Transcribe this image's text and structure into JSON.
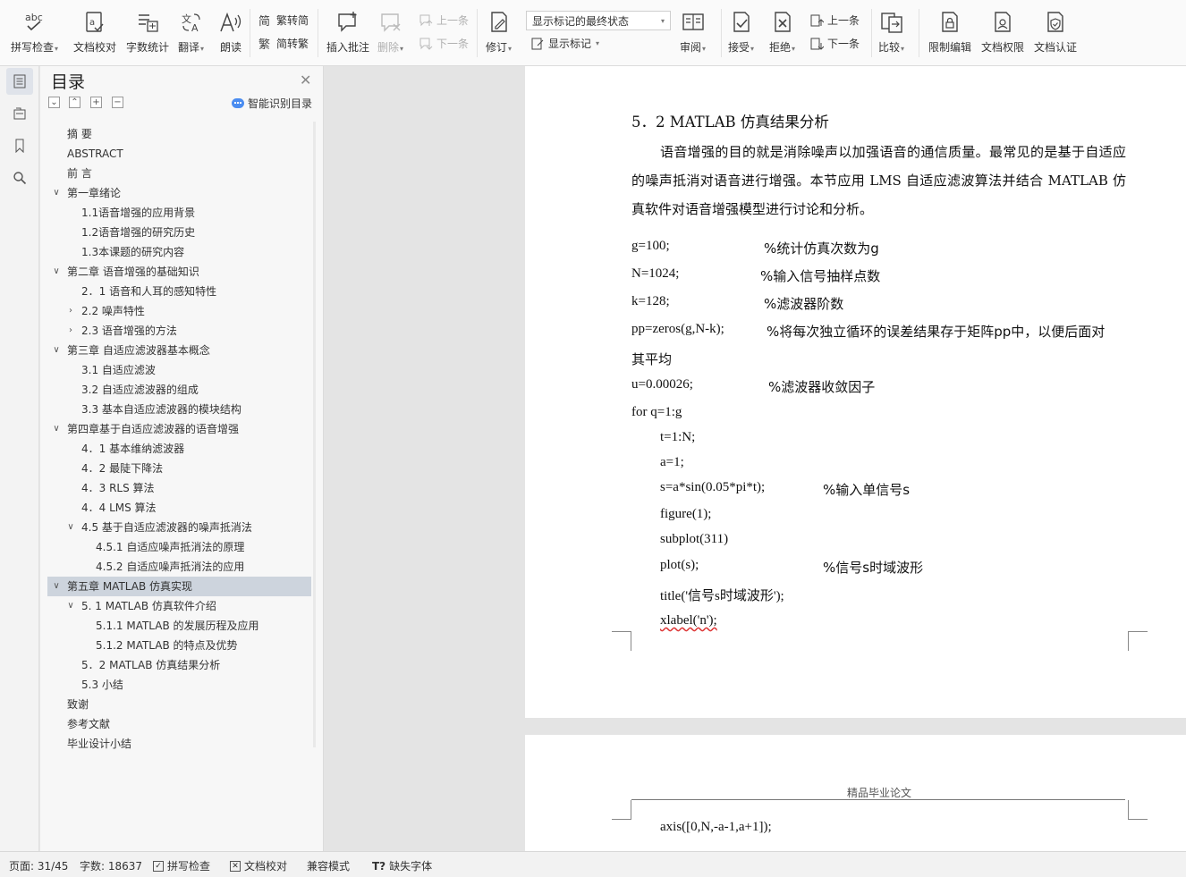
{
  "ribbon": {
    "spell_check": "拼写检查",
    "doc_proof": "文档校对",
    "word_count": "字数统计",
    "translate": "翻译",
    "read_aloud": "朗读",
    "trad_to_simp": "繁转简",
    "simp_to_trad": "简转繁",
    "insert_comment": "插入批注",
    "delete": "删除",
    "prev_comment": "上一条",
    "next_comment": "下一条",
    "revise": "修订",
    "markup_dropdown": "显示标记的最终状态",
    "show_markup": "显示标记",
    "review": "审阅",
    "accept": "接受",
    "reject": "拒绝",
    "prev_change": "上一条",
    "next_change": "下一条",
    "compare": "比较",
    "restrict_edit": "限制编辑",
    "doc_permission": "文档权限",
    "doc_certify": "文档认证"
  },
  "toc": {
    "title": "目录",
    "smart_toc": "智能识别目录",
    "items": [
      {
        "label": "摘  要",
        "level": 0
      },
      {
        "label": "ABSTRACT",
        "level": 0
      },
      {
        "label": "前  言",
        "level": 0
      },
      {
        "label": "第一章绪论",
        "level": 0,
        "arrow": "expanded"
      },
      {
        "label": "1.1语音增强的应用背景",
        "level": 1
      },
      {
        "label": "1.2语音增强的研究历史",
        "level": 1
      },
      {
        "label": "1.3本课题的研究内容",
        "level": 1
      },
      {
        "label": "第二章  语音增强的基础知识",
        "level": 0,
        "arrow": "expanded"
      },
      {
        "label": "2．1  语音和人耳的感知特性",
        "level": 1
      },
      {
        "label": "2.2  噪声特性",
        "level": 1,
        "arrow": "collapsed"
      },
      {
        "label": "2.3    语音增强的方法",
        "level": 1,
        "arrow": "collapsed"
      },
      {
        "label": "第三章    自适应滤波器基本概念",
        "level": 0,
        "arrow": "expanded"
      },
      {
        "label": "3.1 自适应滤波",
        "level": 1
      },
      {
        "label": "3.2 自适应滤波器的组成",
        "level": 1
      },
      {
        "label": "3.3 基本自适应滤波器的模块结构",
        "level": 1
      },
      {
        "label": "第四章基于自适应滤波器的语音增强",
        "level": 0,
        "arrow": "expanded"
      },
      {
        "label": "4．1     基本维纳滤波器",
        "level": 1
      },
      {
        "label": "4．2 最陡下降法",
        "level": 1
      },
      {
        "label": "4．3    RLS 算法",
        "level": 1
      },
      {
        "label": "4．4    LMS 算法",
        "level": 1
      },
      {
        "label": "4.5  基于自适应滤波器的噪声抵消法",
        "level": 1,
        "arrow": "expanded"
      },
      {
        "label": "4.5.1 自适应噪声抵消法的原理",
        "level": 2
      },
      {
        "label": "4.5.2 自适应噪声抵消法的应用",
        "level": 2
      },
      {
        "label": "第五章  MATLAB 仿真实现",
        "level": 0,
        "arrow": "expanded",
        "selected": true
      },
      {
        "label": "5. 1 MATLAB 仿真软件介绍",
        "level": 1,
        "arrow": "expanded"
      },
      {
        "label": "5.1.1 MATLAB 的发展历程及应用",
        "level": 2
      },
      {
        "label": "5.1.2    MATLAB 的特点及优势",
        "level": 2
      },
      {
        "label": "5．2    MATLAB 仿真结果分析",
        "level": 1
      },
      {
        "label": "5.3 小结",
        "level": 1
      },
      {
        "label": "致谢",
        "level": 0
      },
      {
        "label": "参考文献",
        "level": 0
      },
      {
        "label": "毕业设计小结",
        "level": 0
      }
    ]
  },
  "doc": {
    "heading": "5．2    MATLAB 仿真结果分析",
    "paragraph": "语音增强的目的就是消除噪声以加强语音的通信质量。最常见的是基于自适应的噪声抵消对语音进行增强。本节应用 LMS 自适应滤波算法并结合 MATLAB 仿真软件对语音增强模型进行讨论和分析。",
    "code": [
      {
        "code": "g=100;",
        "comment": "%统计仿真次数为g"
      },
      {
        "code": "N=1024;",
        "comment": "%输入信号抽样点数"
      },
      {
        "code": "k=128;",
        "comment": "%滤波器阶数"
      },
      {
        "code": "pp=zeros(g,N-k);",
        "comment": "%将每次独立循环的误差结果存于矩阵pp中，以便后面对"
      },
      {
        "code": "",
        "comment": "其平均"
      },
      {
        "code": "u=0.00026;",
        "comment": "%滤波器收敛因子"
      },
      {
        "code": "for q=1:g",
        "comment": ""
      },
      {
        "code": "t=1:N;",
        "comment": ""
      },
      {
        "code": "a=1;",
        "comment": ""
      },
      {
        "code": "s=a*sin(0.05*pi*t);",
        "comment": "%输入单信号s"
      },
      {
        "code": "figure(1);",
        "comment": ""
      },
      {
        "code": "subplot(311)",
        "comment": ""
      },
      {
        "code": "plot(s);",
        "comment": "%信号s时域波形"
      },
      {
        "code": "title('信号s时域波形');",
        "comment": ""
      },
      {
        "code": "xlabel('n');",
        "comment": ""
      }
    ],
    "page2_header": "精品毕业论文",
    "page2_code": "axis([0,N,-a-1,a+1]);"
  },
  "status": {
    "page": "页面: 31/45",
    "words": "字数: 18637",
    "spell_check": "拼写检查",
    "doc_proof": "文档校对",
    "compat_mode": "兼容模式",
    "missing_font": "缺失字体"
  }
}
